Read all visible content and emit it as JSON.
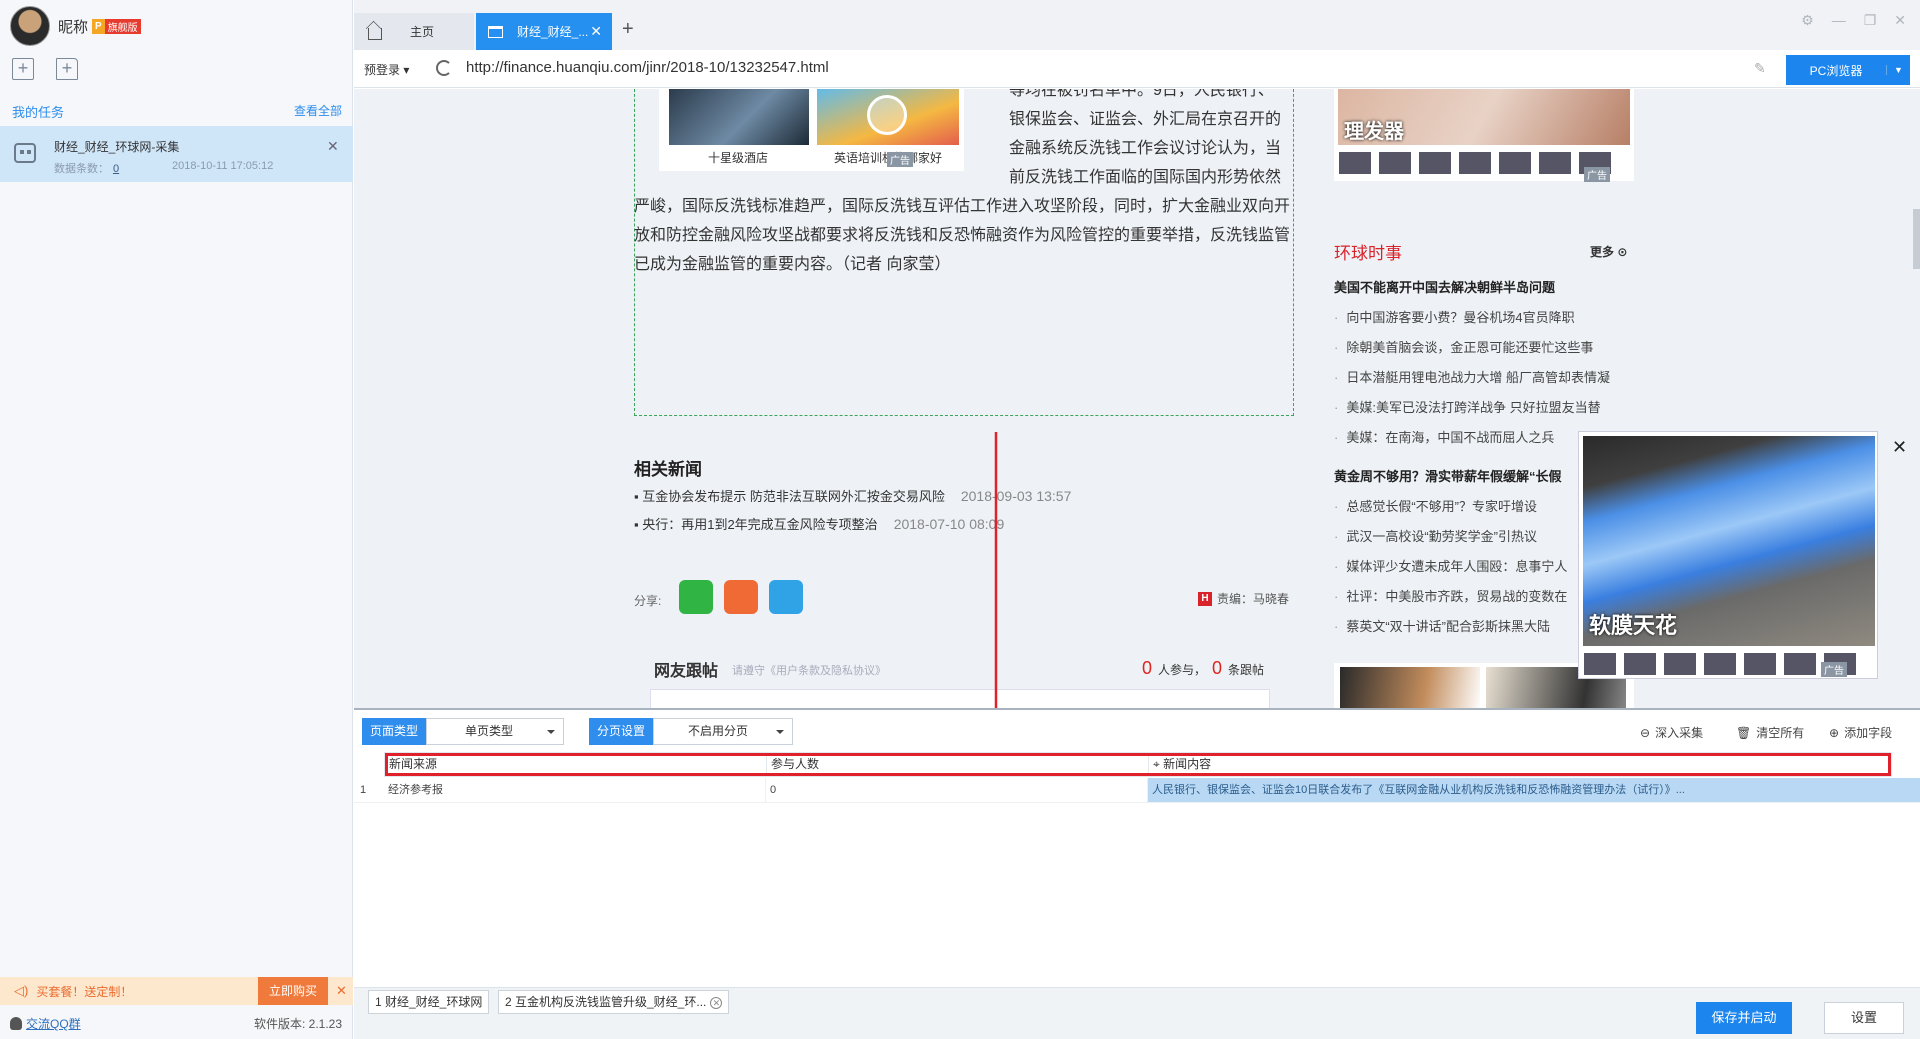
{
  "sidebar": {
    "nickname": "昵称",
    "vip_p": "P",
    "vip_label": "旗舰版",
    "my_tasks": "我的任务",
    "view_all": "查看全部",
    "task": {
      "title": "财经_财经_环球网-采集",
      "count_label": "数据条数：",
      "count": "0",
      "time": "2018-10-11 17:05:12"
    },
    "promo_text": "买套餐！送定制！",
    "promo_buy": "立即购买",
    "qq_group": "交流QQ群",
    "version": "软件版本: 2.1.23"
  },
  "tabs": {
    "home": "主页",
    "active": "财经_财经_..."
  },
  "address": {
    "login": "预登录",
    "url": "http://finance.huanqiu.com/jinr/2018-10/13232547.html",
    "browser_mode": "PC浏览器"
  },
  "page": {
    "ad_left_caption1": "十星级酒店",
    "ad_left_caption2": "英语培训机构哪家好",
    "ad_tag": "广告",
    "article_lines": [
      "等均在被罚名单中。9日，人民银行、",
      "银保监会、证监会、外汇局在京召开的",
      "金融系统反洗钱工作会议讨论认为，当",
      "前反洗钱工作面临的国际国内形势依然",
      "严峻，国际反洗钱标准趋严，国际反洗钱互评估工作进入攻坚阶段，同时，扩大金融业双向开",
      "放和防控金融风险攻坚战都要求将反洗钱和反恐怖融资作为风险管控的重要举措，反洗钱监管",
      "已成为金融监管的重要内容。（记者 向家莹）"
    ],
    "related_title": "相关新闻",
    "related": [
      {
        "title": "▪ 互金协会发布提示 防范非法互联网外汇按金交易风险",
        "date": "2018-09-03 13:57"
      },
      {
        "title": "▪ 央行：再用1到2年完成互金风险专项整治",
        "date": "2018-07-10 08:09"
      }
    ],
    "share_label": "分享:",
    "editor": "责编：马晓春",
    "editor_h": "H",
    "comment_title": "网友跟帖",
    "comment_hint": "请遵守《用户条款及隐私协议》",
    "comment_participants": "0",
    "comment_participants_label": "人参与，",
    "comment_posts": "0",
    "comment_posts_label": "条跟帖",
    "right_ad_caption": "理发器",
    "section_title": "环球时事",
    "section_more": "更多",
    "news_bold1": "美国不能离开中国去解决朝鲜半岛问题",
    "news1": [
      "向中国游客要小费？曼谷机场4官员降职",
      "除朝美首脑会谈，金正恩可能还要忙这些事",
      "日本潜艇用锂电池战力大增 船厂高管却表情凝",
      "美媒:美军已没法打跨洋战争 只好拉盟友当替",
      "美媒：在南海，中国不战而屈人之兵"
    ],
    "news_bold2": "黄金周不够用？滑实带薪年假缓解“长假",
    "news2": [
      "总感觉长假“不够用”？专家吁增设",
      "武汉一高校设“勤劳奖学金”引热议",
      "媒体评少女遭未成年人围殴：息事宁人",
      "社评：中美股市齐跌，贸易战的变数在",
      "蔡英文“双十讲话”配合彭斯抹黑大陆"
    ],
    "float_ad_caption": "软膜天花"
  },
  "panel": {
    "page_type_label": "页面类型",
    "page_type_value": "单页类型",
    "paging_label": "分页设置",
    "paging_value": "不启用分页",
    "deep_collect": "深入采集",
    "clear_all": "清空所有",
    "add_field": "添加字段",
    "fields": [
      "新闻来源",
      "参与人数",
      "新闻内容"
    ],
    "row": {
      "index": "1",
      "values": [
        "经济参考报",
        "0",
        "人民银行、银保监会、证监会10日联合发布了《互联网金融从业机构反洗钱和反恐怖融资管理办法（试行）》..."
      ]
    }
  },
  "bottom": {
    "tab1": "1 财经_财经_环球网",
    "tab2": "2 互金机构反洗钱监管升级_财经_环...",
    "save_start": "保存并启动",
    "settings": "设置"
  },
  "colors": {
    "accent": "#2e8ded",
    "highlight": "#e0202a",
    "news_red": "#d9232b"
  }
}
